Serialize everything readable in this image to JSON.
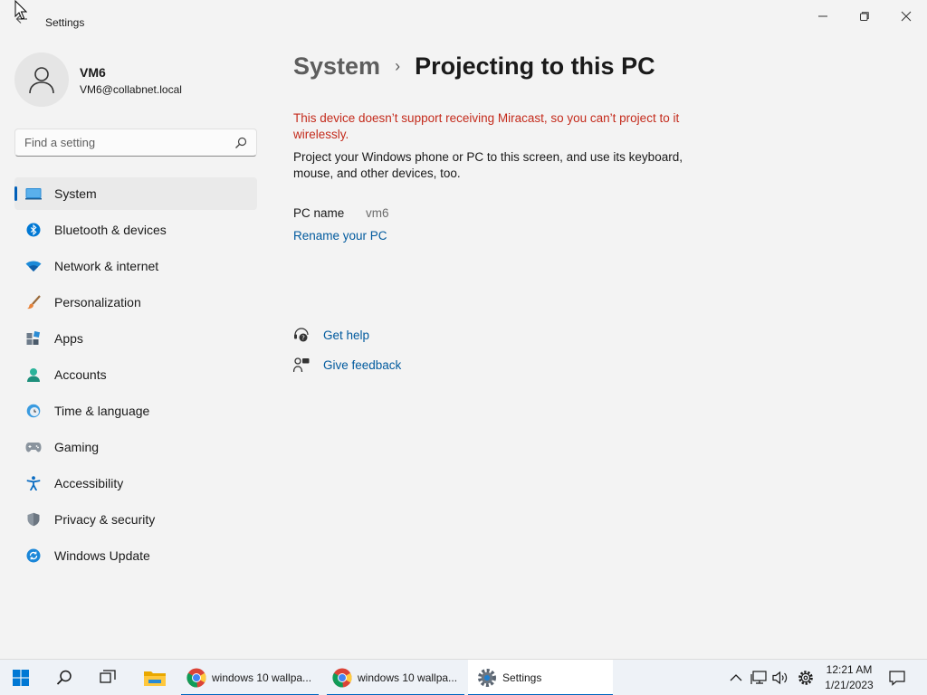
{
  "window": {
    "title": "Settings",
    "back_icon": "back-arrow-icon"
  },
  "profile": {
    "name": "VM6",
    "email": "VM6@collabnet.local"
  },
  "search": {
    "placeholder": "Find a setting"
  },
  "nav": {
    "items": [
      {
        "label": "System",
        "icon": "system-icon",
        "active": true
      },
      {
        "label": "Bluetooth & devices",
        "icon": "bluetooth-icon"
      },
      {
        "label": "Network & internet",
        "icon": "wifi-icon"
      },
      {
        "label": "Personalization",
        "icon": "brush-icon"
      },
      {
        "label": "Apps",
        "icon": "apps-icon"
      },
      {
        "label": "Accounts",
        "icon": "accounts-icon"
      },
      {
        "label": "Time & language",
        "icon": "clock-globe-icon"
      },
      {
        "label": "Gaming",
        "icon": "gamepad-icon"
      },
      {
        "label": "Accessibility",
        "icon": "accessibility-icon"
      },
      {
        "label": "Privacy & security",
        "icon": "shield-icon"
      },
      {
        "label": "Windows Update",
        "icon": "update-icon"
      }
    ]
  },
  "main": {
    "breadcrumb_parent": "System",
    "breadcrumb_separator": "›",
    "title": "Projecting to this PC",
    "warning": "This device doesn’t support receiving Miracast, so you can’t project to it wirelessly.",
    "description": "Project your Windows phone or PC to this screen, and use its keyboard, mouse, and other devices, too.",
    "pc_name_label": "PC name",
    "pc_name_value": "vm6",
    "rename_link": "Rename your PC",
    "get_help": "Get help",
    "give_feedback": "Give feedback"
  },
  "taskbar": {
    "apps": [
      {
        "label": "windows 10 wallpa...",
        "icon": "chrome-icon"
      },
      {
        "label": "windows 10 wallpa...",
        "icon": "chrome-icon"
      },
      {
        "label": "Settings",
        "icon": "settings-gear-icon"
      }
    ],
    "time": "12:21 AM",
    "date": "1/21/2023"
  },
  "colors": {
    "accent": "#005fb8",
    "link": "#005a9e",
    "warning": "#c42b1c",
    "background": "#f3f3f3"
  }
}
